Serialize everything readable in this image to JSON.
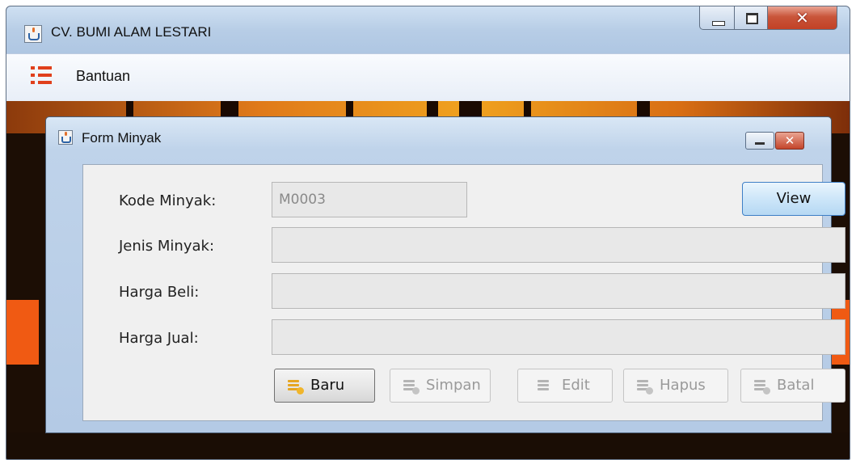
{
  "window": {
    "title": "CV. BUMI ALAM LESTARI"
  },
  "menubar": {
    "items": [
      {
        "label": "Bantuan"
      }
    ]
  },
  "form": {
    "title": "Form Minyak",
    "fields": [
      {
        "label": "Kode Minyak:",
        "value": "M0003"
      },
      {
        "label": "Jenis Minyak:",
        "value": ""
      },
      {
        "label": "Harga Beli:",
        "value": ""
      },
      {
        "label": "Harga Jual:",
        "value": ""
      }
    ],
    "view_label": "View",
    "buttons": [
      {
        "label": "Baru",
        "enabled": true
      },
      {
        "label": "Simpan",
        "enabled": false
      },
      {
        "label": "Edit",
        "enabled": false
      },
      {
        "label": "Hapus",
        "enabled": false
      },
      {
        "label": "Batal",
        "enabled": false
      }
    ]
  },
  "colors": {
    "accent_orange": "#f05a13",
    "title_bar": "#b7cde6",
    "close_red": "#c24126"
  }
}
